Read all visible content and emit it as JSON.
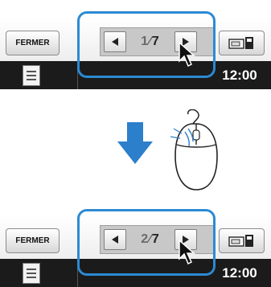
{
  "top_panel": {
    "close_label": "FERMER",
    "page_current": "1",
    "page_total": "7",
    "time": "12:00"
  },
  "bottom_panel": {
    "close_label": "FERMER",
    "page_current": "2",
    "page_total": "7",
    "time": "12:00"
  },
  "colors": {
    "highlight": "#2c8ad3",
    "status_bar": "#1b1b1b",
    "arrow": "#2c7fca"
  },
  "icons": {
    "prev": "triangle-left-icon",
    "next": "triangle-right-icon",
    "settings": "machine-icon",
    "document": "document-icon",
    "cursor": "mouse-pointer-icon",
    "transition": "down-arrow-icon",
    "mouse": "computer-mouse-icon"
  }
}
